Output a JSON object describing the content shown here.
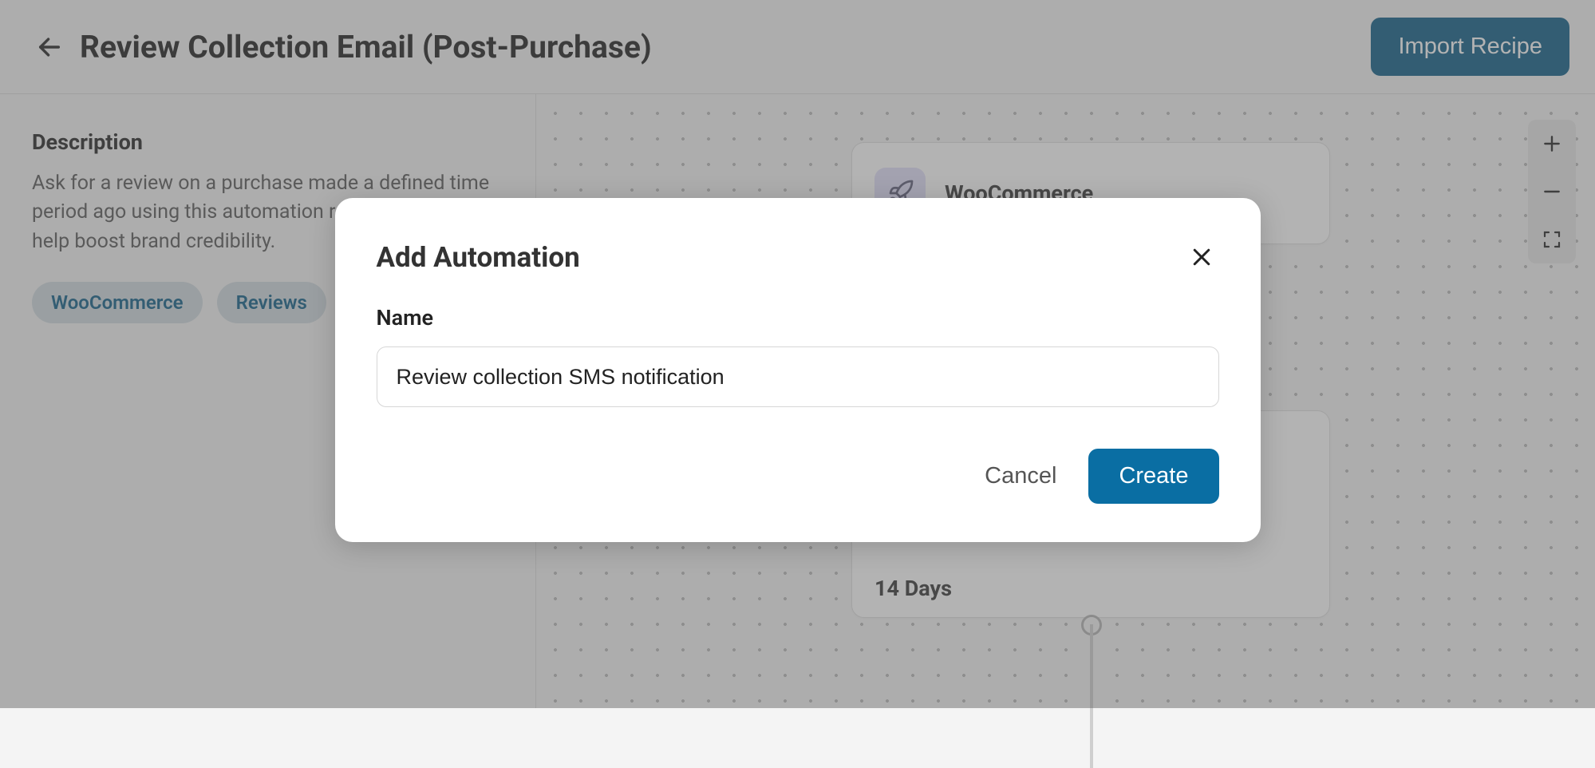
{
  "header": {
    "title": "Review Collection Email (Post-Purchase)",
    "import_label": "Import Recipe"
  },
  "sidebar": {
    "desc_heading": "Description",
    "desc_text": "Ask for a review on a purchase made a defined time period ago using this automation recipe. Reviews help boost brand credibility.",
    "tags": [
      "WooCommerce",
      "Reviews"
    ]
  },
  "canvas": {
    "trigger_label": "WooCommerce",
    "delay_label": "14 Days"
  },
  "modal": {
    "title": "Add Automation",
    "name_label": "Name",
    "name_value": "Review collection SMS notification",
    "cancel_label": "Cancel",
    "create_label": "Create"
  }
}
